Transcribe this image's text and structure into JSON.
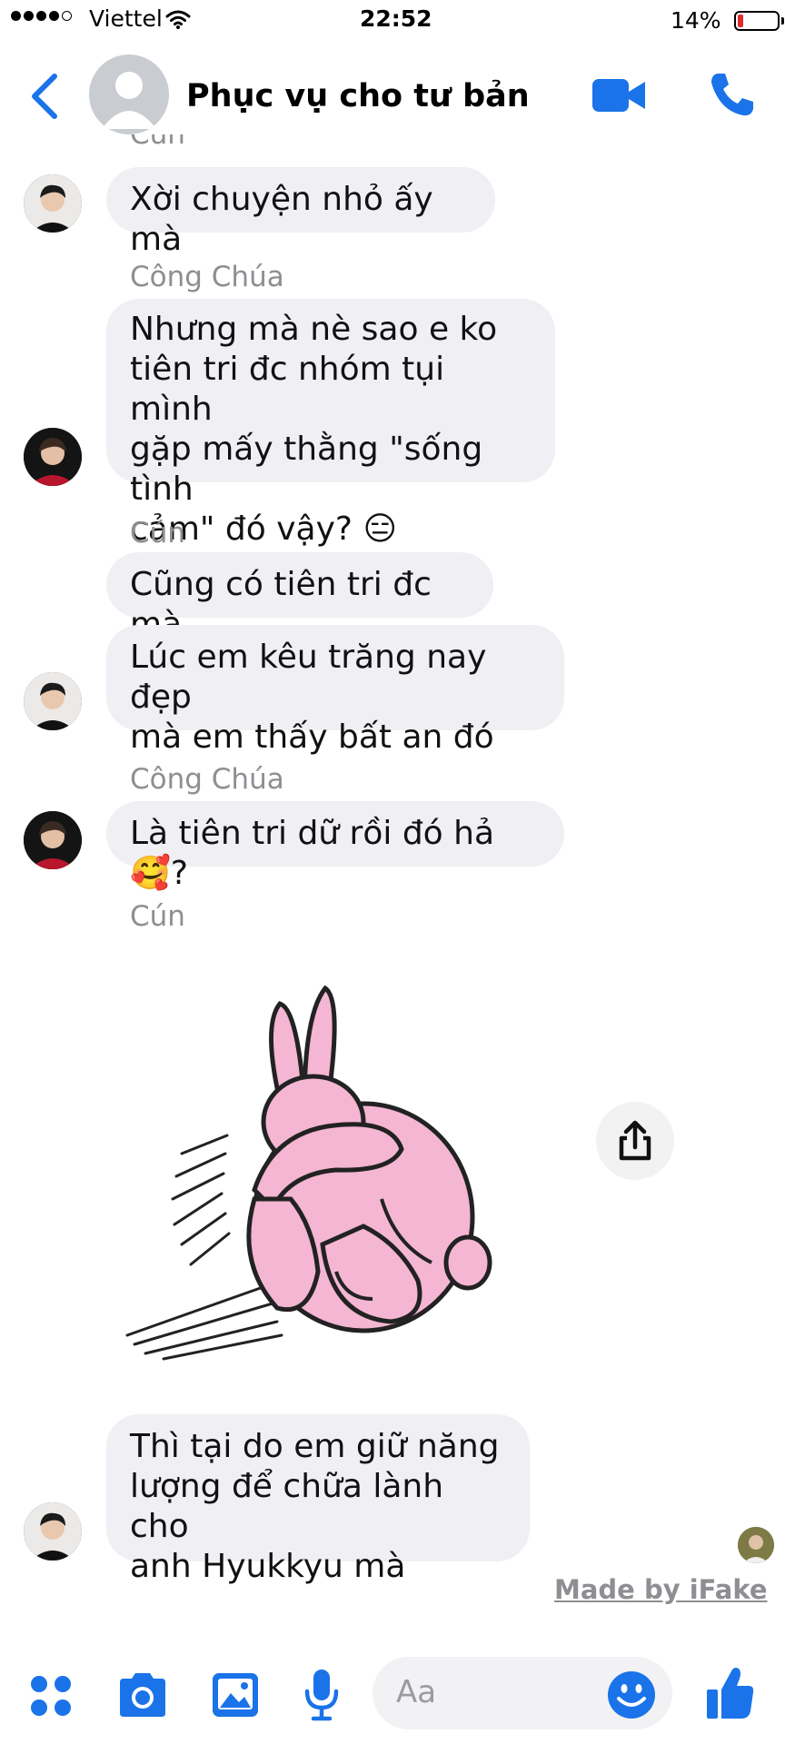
{
  "status_bar": {
    "carrier": "Viettel",
    "time": "22:52",
    "battery_percent": "14%",
    "battery_level": 0.14
  },
  "header": {
    "contact_name": "Phục vụ cho tư bản",
    "icons": [
      "back-chevron-icon",
      "video-call-icon",
      "phone-icon"
    ]
  },
  "messages": [
    {
      "sender": "Cún",
      "bubbles": [
        "Xời chuyện nhỏ ấy mà"
      ]
    },
    {
      "sender": "Công Chúa",
      "bubbles": [
        "Nhưng mà nè sao e ko\ntiên tri đc nhóm tụi mình\ngặp mấy thằng \"sống tình\ncảm\" đó vậy? 😑"
      ]
    },
    {
      "sender": "Cún",
      "bubbles": [
        "Cũng có tiên tri đc mà",
        "Lúc em kêu trăng nay đẹp\nmà em thấy bất an đó"
      ]
    },
    {
      "sender": "Công Chúa",
      "bubbles": [
        "Là tiên tri dữ rồi đó hả🥰?"
      ]
    },
    {
      "sender": "Cún",
      "sticker": "pink-bunny-sticker"
    },
    {
      "sender": "",
      "bubbles": [
        "Thì tại do em giữ năng\nlượng để chữa lành cho\nanh Hyukkyu mà"
      ]
    }
  ],
  "watermark": "Made by iFake",
  "composer": {
    "placeholder": "Aa",
    "icons": [
      "menu-dots-icon",
      "camera-icon",
      "photo-icon",
      "microphone-icon",
      "emoji-icon",
      "like-thumb-icon"
    ]
  },
  "colors": {
    "accent": "#1a73e8",
    "bubble_bg": "#efeff4",
    "sender_gray": "#8e8e93",
    "battery_low": "#e02b2b",
    "sticker_pink": "#f4b6d2"
  }
}
